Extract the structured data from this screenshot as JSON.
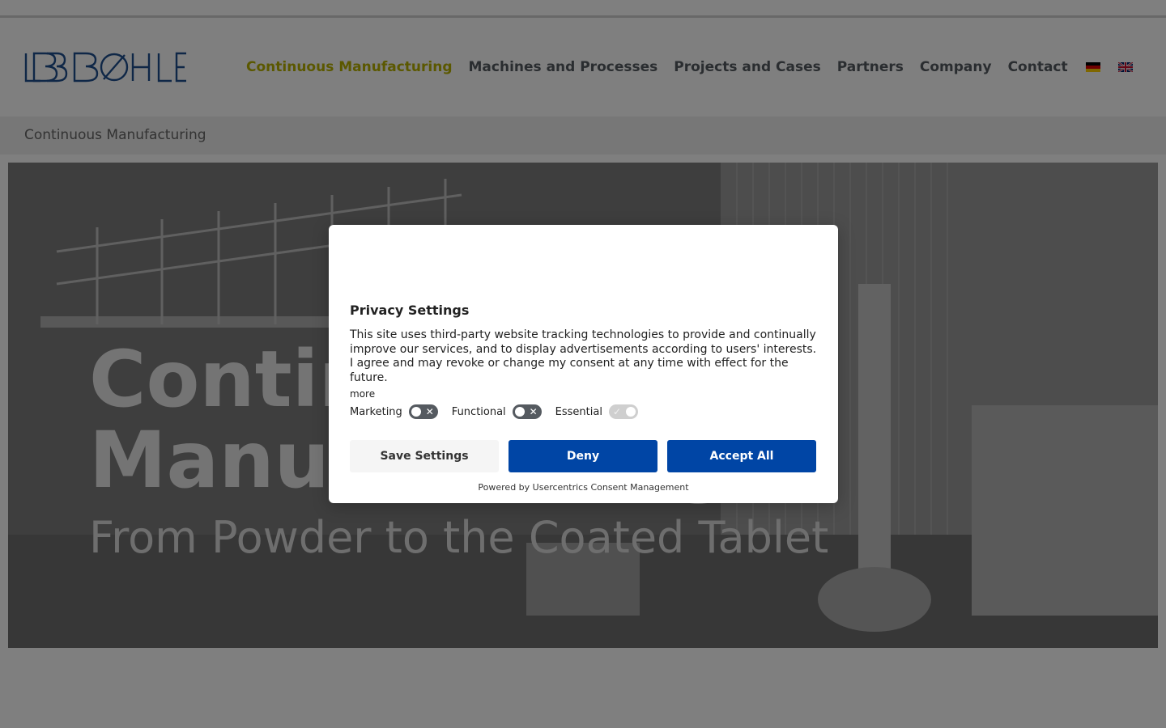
{
  "nav": {
    "items": [
      {
        "label": "Continuous Manufacturing",
        "active": true
      },
      {
        "label": "Machines and Processes"
      },
      {
        "label": "Projects and Cases"
      },
      {
        "label": "Partners"
      },
      {
        "label": "Company"
      },
      {
        "label": "Contact"
      }
    ],
    "languages": [
      "de-flag-icon",
      "uk-flag-icon"
    ]
  },
  "breadcrumb": "Continuous Manufacturing",
  "hero": {
    "title_line1": "Continuous",
    "title_line2": "Manufacturing",
    "subtitle": "From Powder to the Coated Tablet"
  },
  "consent": {
    "title": "Privacy Settings",
    "text": "This site uses third-party website tracking technologies to provide and continually improve our services, and to display advertisements according to users' interests. I agree and may revoke or change my consent at any time with effect for the future.",
    "more": "more",
    "toggles": [
      {
        "label": "Marketing",
        "state": "off"
      },
      {
        "label": "Functional",
        "state": "off"
      },
      {
        "label": "Essential",
        "state": "on"
      }
    ],
    "buttons": {
      "save": "Save Settings",
      "deny": "Deny",
      "accept": "Accept All"
    },
    "powered_by": "Powered by Usercentrics Consent Management"
  },
  "colors": {
    "accent_nav": "#b7b000",
    "button_primary": "#0045a5",
    "logo": "#1f4f8f"
  }
}
